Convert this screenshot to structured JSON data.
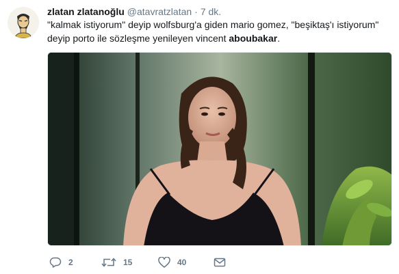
{
  "tweet": {
    "display_name": "zlatan zlatanoğlu",
    "handle": "@atavratzlatan",
    "separator": "·",
    "time": "7 dk.",
    "text_before": "\"kalmak istiyorum\" deyip wolfsburg'a giden mario gomez, \"beşiktaş'ı istiyorum\" deyip porto ile sözleşme yenileyen vincent ",
    "text_bold": "aboubakar",
    "text_after": "."
  },
  "actions": {
    "reply_count": "2",
    "retweet_count": "15",
    "like_count": "40"
  },
  "icons": {
    "reply": "reply-icon",
    "retweet": "retweet-icon",
    "like": "heart-icon",
    "dm": "envelope-icon"
  },
  "colors": {
    "text": "#14171a",
    "muted": "#657786"
  }
}
